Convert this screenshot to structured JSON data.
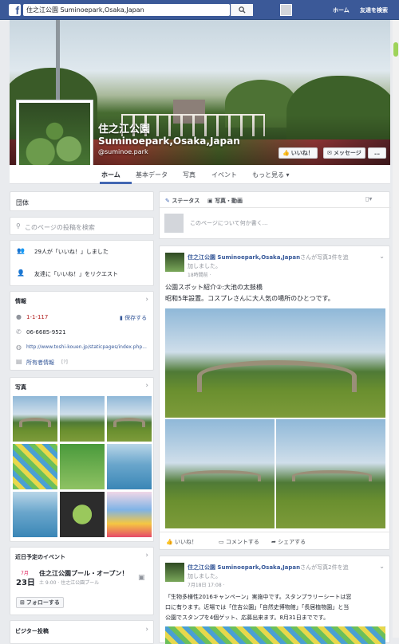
{
  "topbar": {
    "search_value": "住之江公園 Suminoepark,Osaka,Japan",
    "home": "ホーム",
    "find_friends": "友達を検索"
  },
  "page": {
    "title": "住之江公園",
    "subtitle": "Suminoepark,Osaka,Japan",
    "handle": "@suminoe.park"
  },
  "cover_buttons": {
    "like": "いいね！",
    "message": "メッセージ",
    "more": "…"
  },
  "tabs": [
    "ホーム",
    "基本データ",
    "写真",
    "イベント",
    "もっと見る"
  ],
  "sidebar": {
    "category": "団体",
    "search_placeholder": "このページの投稿を検索",
    "likes": "29人が「いいね！」しました",
    "invite": "友達に「いいね！」をリクエスト",
    "info_header": "情報",
    "address": "1-1-117",
    "save": "保存する",
    "phone": "06-6685-9521",
    "url": "http://www.toshi-kouen.jp/staticpages/index.php...",
    "owner": "所有者情報",
    "owner_note": "[?]",
    "photos_header": "写真",
    "events_header": "近日予定のイベント",
    "event_month": "7月",
    "event_day": "23日",
    "event_title": "住之江公園プール・オープン！",
    "event_time": "土 9:00 · 住之江公園プール",
    "follow": "フォローする",
    "visitor_header": "ビジター投稿"
  },
  "composer": {
    "status": "ステータス",
    "photo_video": "写真・動画",
    "placeholder": "このページについて何か書く…"
  },
  "post1": {
    "author": "住之江公園 Suminoepark,Osaka,Japan",
    "action_text": "さんが写真3件を追",
    "action_text2": "加しました。",
    "time": "18時間前 ·",
    "line1": "公園スポット紹介②:大池の太鼓橋",
    "line2": "昭和5年設置。コスプレさんに大人気の場所のひとつです。",
    "like": "いいね！",
    "comment": "コメントする",
    "share": "シェアする"
  },
  "post2": {
    "author": "住之江公園 Suminoepark,Osaka,Japan",
    "action_text": "さんが写真2件を追",
    "action_text2": "加しました。",
    "time": "7月18日 17:08 ·",
    "line1": "「生物多様性2016キャンペーン」実施中です。スタンプラリーシートは窓",
    "line2": "口に有ります。近場では「住吉公園」「自然史博物館」「長居植物園」と当",
    "line3": "公園でスタンプを4個ゲット、応募出来ます。8月31日までです。"
  }
}
